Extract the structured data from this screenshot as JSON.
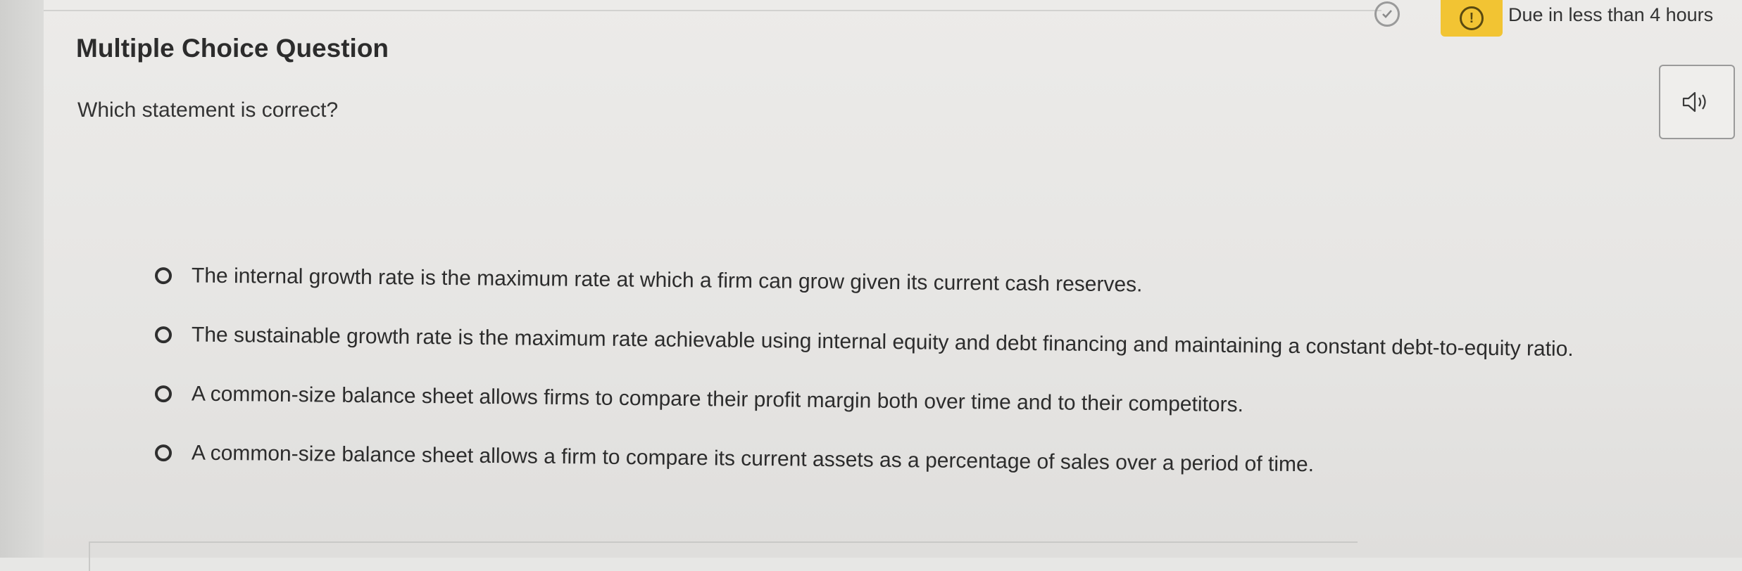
{
  "status_bar": {
    "check_icon": "check-circle-icon",
    "alert_icon": "exclamation-circle-icon",
    "alert_symbol": "!",
    "due_text": "Due in less than 4 hours",
    "alert_color": "#f2c433"
  },
  "question": {
    "type_title": "Multiple Choice Question",
    "prompt": "Which statement is correct?",
    "speaker_icon": "speaker-icon"
  },
  "options": [
    {
      "label": "The internal growth rate is the maximum rate at which a firm can grow given its current cash reserves."
    },
    {
      "label": "The sustainable growth rate is the maximum rate achievable using internal equity and debt financing and maintaining a constant debt-to-equity ratio."
    },
    {
      "label": "A common-size balance sheet allows firms to compare their profit margin both over time and to their competitors."
    },
    {
      "label": "A common-size balance sheet allows a firm to compare its current assets as a percentage of sales over a period of time."
    }
  ]
}
